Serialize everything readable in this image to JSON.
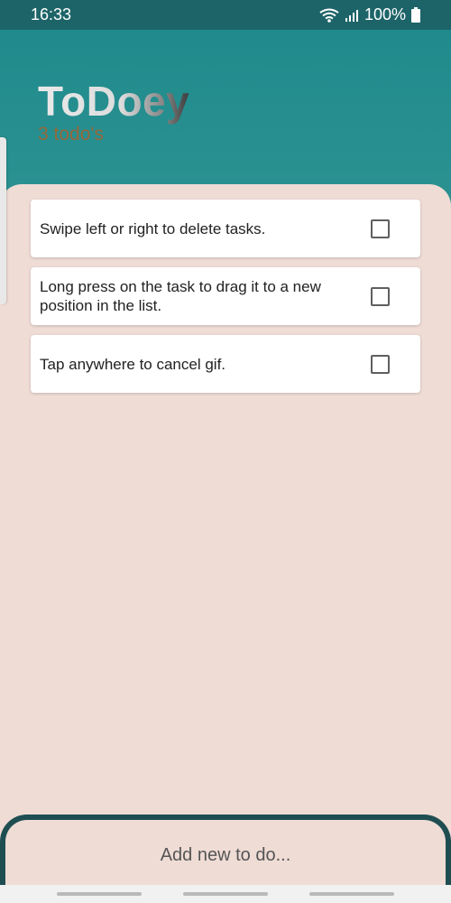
{
  "status": {
    "time": "16:33",
    "battery": "100%"
  },
  "header": {
    "title": "ToDoey",
    "count_label": "3 todo's"
  },
  "tasks": [
    {
      "text": "Swipe left or right to delete tasks.",
      "checked": false
    },
    {
      "text": "Long press on the task to drag it to a new position in the list.",
      "checked": false
    },
    {
      "text": "Tap anywhere to cancel gif.",
      "checked": false
    }
  ],
  "add": {
    "label": "Add new to do..."
  },
  "colors": {
    "header": "#1f8a8c",
    "background": "#efdcd5",
    "accent": "#a8602a",
    "add_border": "#1f4e52"
  }
}
